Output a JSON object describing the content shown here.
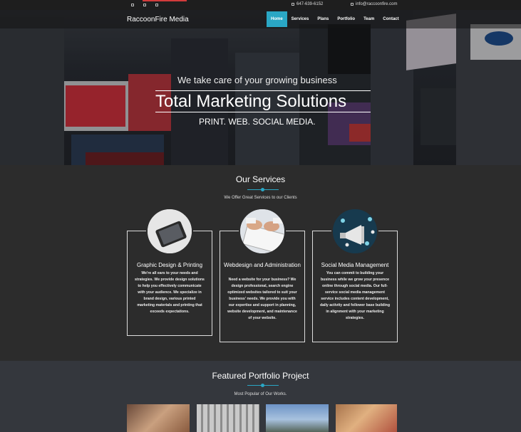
{
  "topbar": {
    "phone": "647-639-6152",
    "email": "info@raccoonfire.com",
    "accent_color": "#d23b3b"
  },
  "nav": {
    "brand": "RaccoonFire Media",
    "items": [
      {
        "label": "Home",
        "active": true
      },
      {
        "label": "Services",
        "active": false
      },
      {
        "label": "Plans",
        "active": false
      },
      {
        "label": "Portfolio",
        "active": false
      },
      {
        "label": "Team",
        "active": false
      },
      {
        "label": "Contact",
        "active": false
      }
    ],
    "active_color": "#2aa7c5"
  },
  "hero": {
    "subtitle": "We take care of your growing business",
    "title": "Total Marketing Solutions",
    "tagline": "PRINT. WEB. SOCIAL MEDIA."
  },
  "services": {
    "title": "Our Services",
    "subtitle": "We Offer Great Services to our Clients",
    "cards": [
      {
        "title": "Graphic Design & Printing",
        "description": "We're all ears to your needs and strategies. We provide design solutions to help you effectively communicate with your audience. We specialize in brand design, various printed marketing materials and printing that exceeds expectations.",
        "icon": "tablet-icon"
      },
      {
        "title": "Webdesign and Administration",
        "description": "Need a website for your business? We design professional, search engine optimized websites tailored to suit your business' needs. We provide you with our expertise and support in planning, website development, and maintenance of your website.",
        "icon": "keyboard-icon"
      },
      {
        "title": "Social Media Management",
        "description": "You can commit to building your business while we grow your presence online through social media. Our full-service social media management service includes content development, daily activity and follower base building in alignment with your marketing strategies.",
        "icon": "megaphone-icon"
      }
    ]
  },
  "portfolio": {
    "title": "Featured Portfolio Project",
    "subtitle": "Most Popular of Our Works."
  },
  "colors": {
    "background": "#2c2c2c",
    "accent": "#2aa7c5",
    "portfolio_bg": "#34373d"
  }
}
